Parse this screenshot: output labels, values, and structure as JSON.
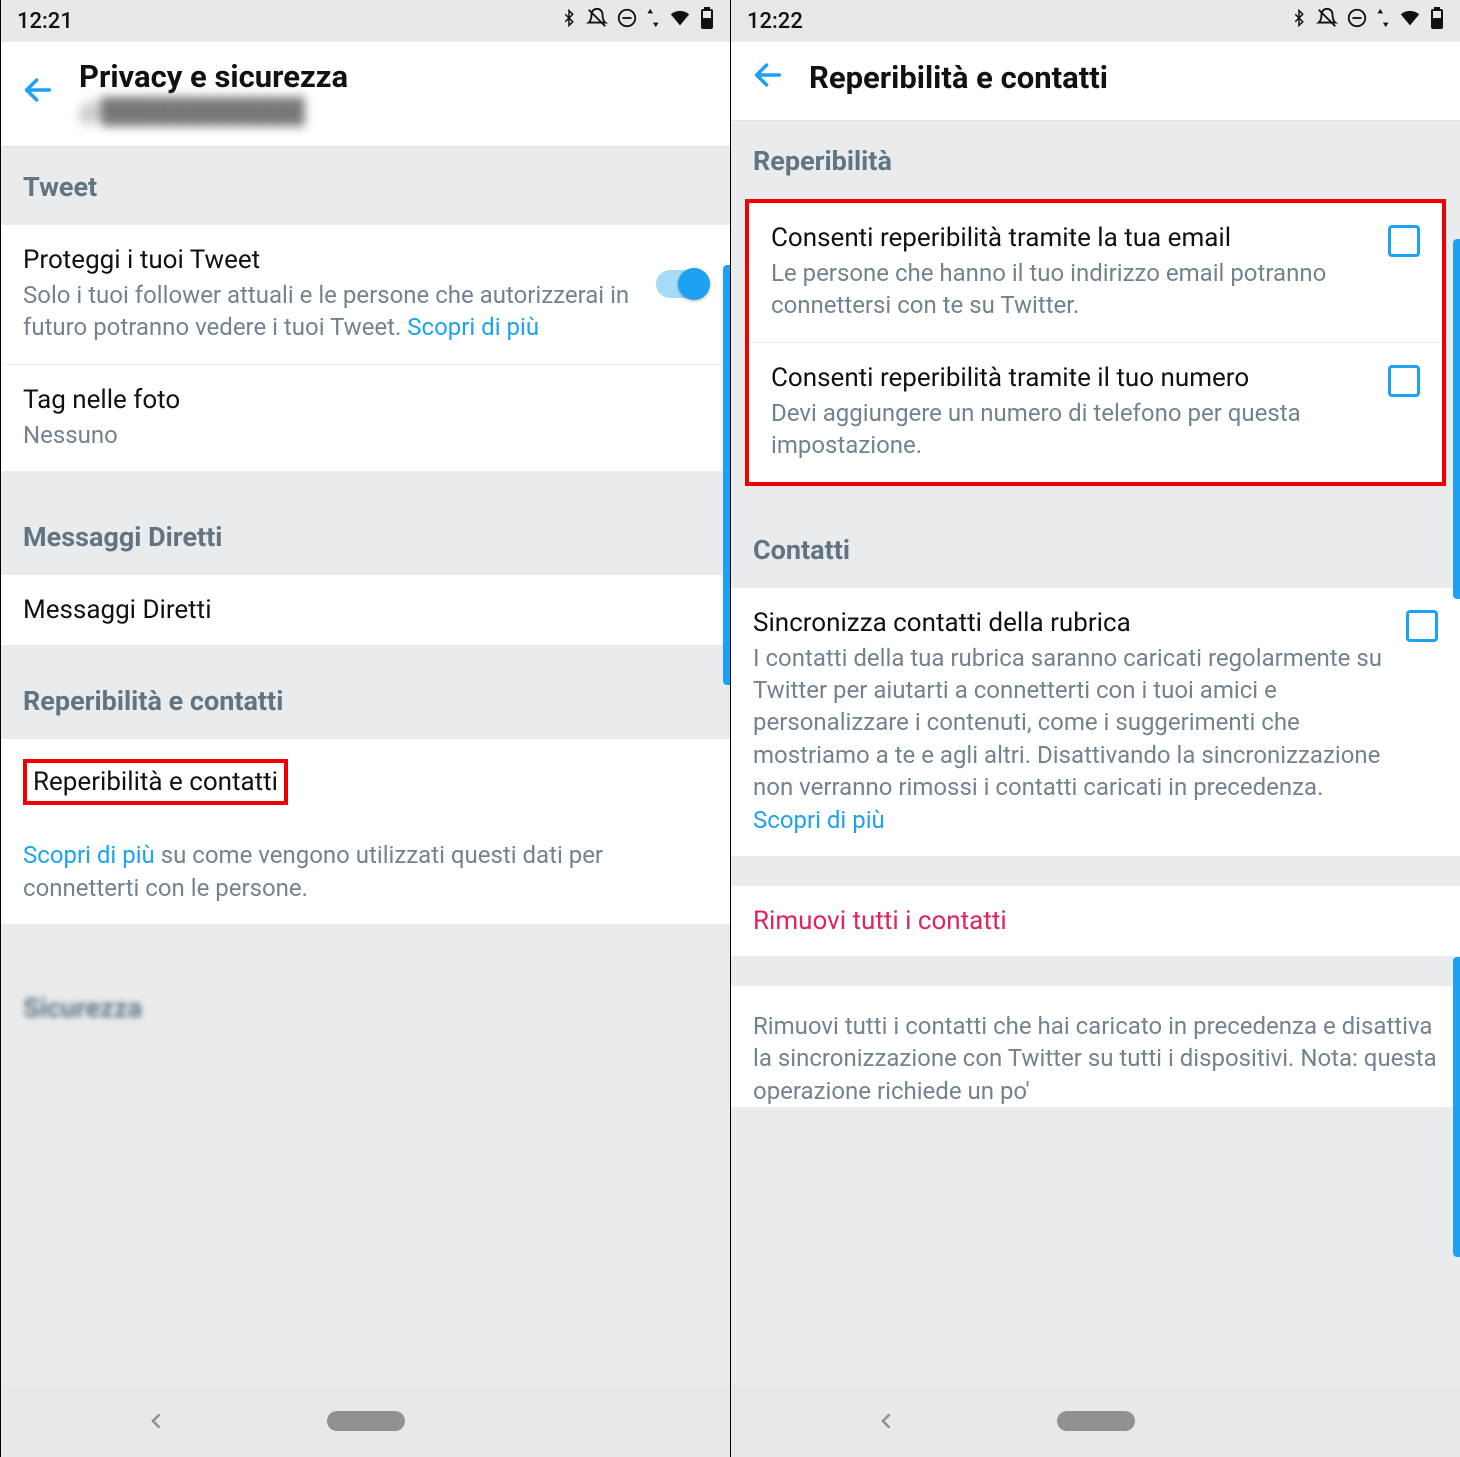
{
  "left": {
    "status_time": "12:21",
    "header_title": "Privacy e sicurezza",
    "header_sub": "@████████████",
    "section_tweet": "Tweet",
    "protect_title": "Proteggi i tuoi Tweet",
    "protect_desc_a": "Solo i tuoi follower attuali e le persone che autorizzerai in futuro potranno vedere i tuoi Tweet. ",
    "protect_link": "Scopri di più",
    "tag_title": "Tag nelle foto",
    "tag_value": "Nessuno",
    "section_dm": "Messaggi Diretti",
    "dm_item": "Messaggi Diretti",
    "section_discover": "Reperibilità e contatti",
    "discover_item": "Reperibilità e contatti",
    "discover_info_a": "Scopri di più",
    "discover_info_b": " su come vengono utilizzati questi dati per connetterti con le persone.",
    "section_security": "Sicurezza"
  },
  "right": {
    "status_time": "12:22",
    "header_title": "Reperibilità e contatti",
    "section_discover": "Reperibilità",
    "email_title": "Consenti reperibilità tramite la tua email",
    "email_desc": "Le persone che hanno il tuo indirizzo email potranno connettersi con te su Twitter.",
    "phone_title": "Consenti reperibilità tramite il tuo numero",
    "phone_desc": "Devi aggiungere un numero di telefono per questa impostazione.",
    "section_contacts": "Contatti",
    "sync_title": "Sincronizza contatti della rubrica",
    "sync_desc_a": "I contatti della tua rubrica saranno caricati regolarmente su Twitter per aiutarti a connetterti con i tuoi amici e personalizzare i contenuti, come i suggerimenti che mostriamo a te e agli altri. Disattivando la sincronizzazione non verranno rimossi i contatti caricati in precedenza. ",
    "sync_link": "Scopri di più",
    "remove_title": "Rimuovi tutti i contatti",
    "remove_desc": "Rimuovi tutti i contatti che hai caricato in precedenza e disattiva la sincronizzazione con Twitter su tutti i dispositivi. Nota: questa operazione richiede un po'"
  }
}
